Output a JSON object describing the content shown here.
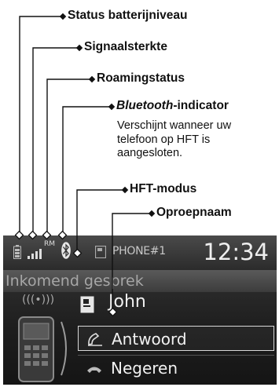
{
  "callouts": {
    "battery": "Status batterijniveau",
    "signal": "Signaalsterkte",
    "roaming": "Roamingstatus",
    "bluetooth_italic": "Bluetooth",
    "bluetooth_rest": "-indicator",
    "bluetooth_note": [
      "Verschijnt wanneer uw",
      "telefoon op HFT is",
      "aangesloten."
    ],
    "hft_mode": "HFT-modus",
    "caller_name": "Oproepnaam"
  },
  "display": {
    "roaming_badge": "RM",
    "phone_label": "PHONE#1",
    "clock": "12:34",
    "incoming_text": "Inkomend gesprek",
    "caller": "John",
    "options": [
      "Antwoord",
      "Negeren"
    ]
  }
}
